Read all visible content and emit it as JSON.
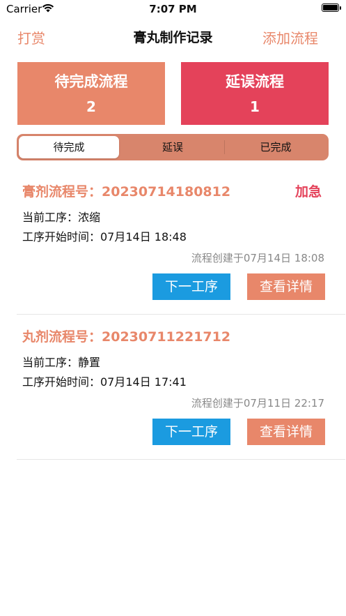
{
  "status_bar": {
    "carrier": "Carrier",
    "time": "7:07 PM",
    "battery": 1.0
  },
  "nav": {
    "left": "打赏",
    "title": "膏丸制作记录",
    "right": "添加流程"
  },
  "summary": {
    "pending": {
      "label": "待完成流程",
      "count": "2",
      "color": "#E8876A"
    },
    "delayed": {
      "label": "延误流程",
      "count": "1",
      "color": "#E4425A"
    }
  },
  "tabs": [
    {
      "label": "待完成",
      "selected": true
    },
    {
      "label": "延误",
      "selected": false
    },
    {
      "label": "已完成",
      "selected": false
    }
  ],
  "records": [
    {
      "title": "膏剂流程号：20230714180812",
      "badge": "加急",
      "step": "当前工序：浓缩",
      "start": "工序开始时间：07月14日 18:48",
      "created": "流程创建于07月14日 18:08",
      "next_label": "下一工序",
      "detail_label": "查看详情"
    },
    {
      "title": "丸剂流程号：20230711221712",
      "badge": "",
      "step": "当前工序：静置",
      "start": "工序开始时间：07月14日 17:41",
      "created": "流程创建于07月11日 22:17",
      "next_label": "下一工序",
      "detail_label": "查看详情"
    }
  ],
  "colors": {
    "accent": "#E8876A",
    "urgent": "#E4425A",
    "primary_button": "#1B9BE0"
  }
}
